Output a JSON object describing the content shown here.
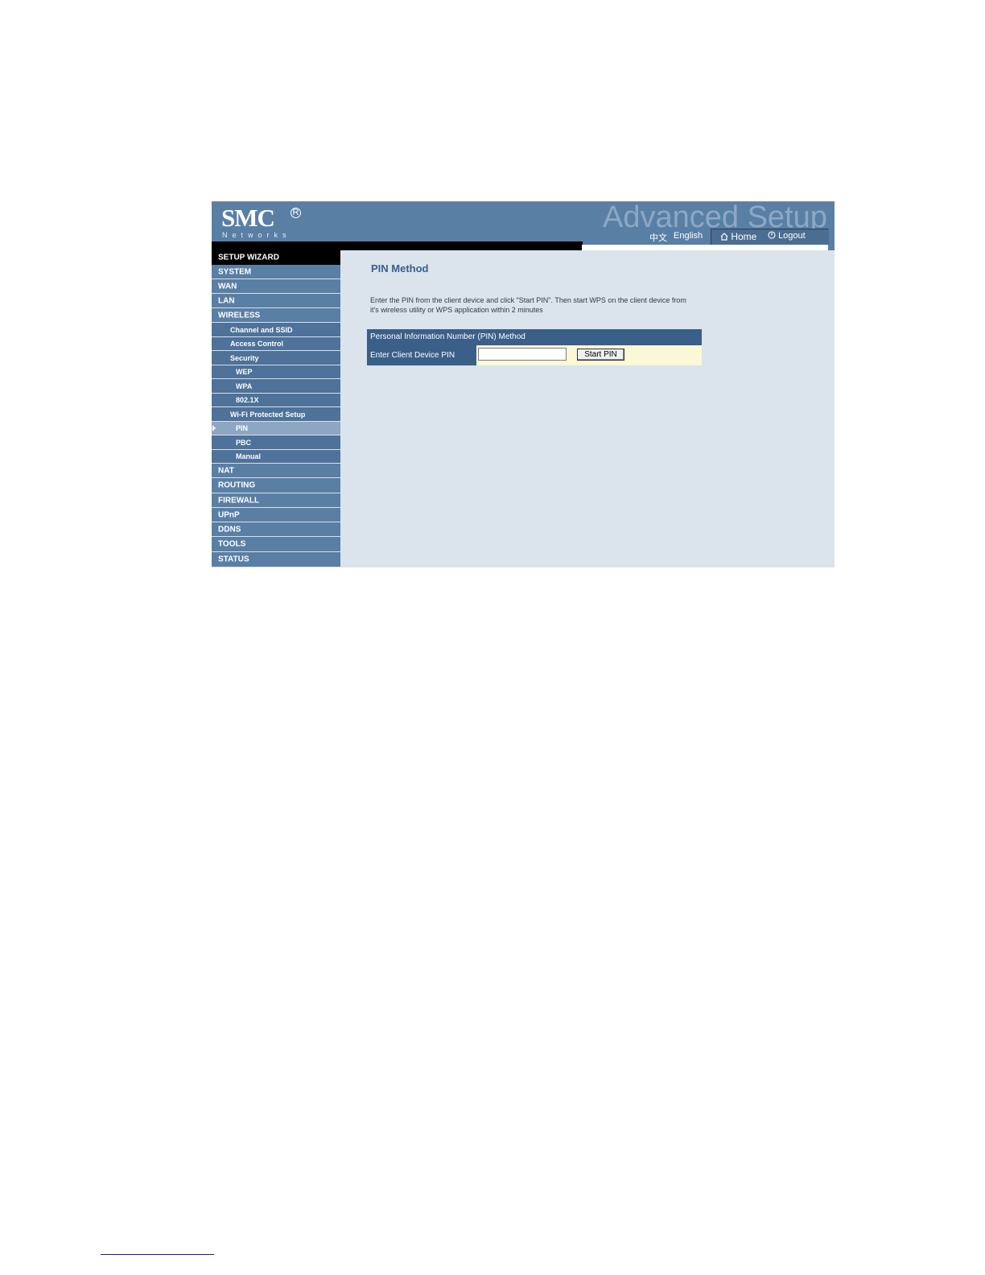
{
  "header": {
    "logo_text": "SMC",
    "logo_sub": "Networks",
    "logo_reg": "R",
    "title": "Advanced Setup",
    "lang_chinese": "中文",
    "lang_english": "English",
    "home": "Home",
    "logout": "Logout"
  },
  "sidebar": {
    "items": [
      {
        "label": "SETUP WIZARD"
      },
      {
        "label": "SYSTEM"
      },
      {
        "label": "WAN"
      },
      {
        "label": "LAN"
      },
      {
        "label": "WIRELESS"
      },
      {
        "label": "Channel and SSID"
      },
      {
        "label": "Access Control"
      },
      {
        "label": "Security"
      },
      {
        "label": "WEP"
      },
      {
        "label": "WPA"
      },
      {
        "label": "802.1X"
      },
      {
        "label": "Wi-Fi Protected Setup"
      },
      {
        "label": "PIN"
      },
      {
        "label": "PBC"
      },
      {
        "label": "Manual"
      },
      {
        "label": "NAT"
      },
      {
        "label": "ROUTING"
      },
      {
        "label": "FIREWALL"
      },
      {
        "label": "UPnP"
      },
      {
        "label": "DDNS"
      },
      {
        "label": "TOOLS"
      },
      {
        "label": "STATUS"
      }
    ]
  },
  "main": {
    "title": "PIN Method",
    "description": "Enter the PIN from the client device and click \"Start PIN\". Then start WPS on the client device from it's wireless utility or WPS application within 2 minutes",
    "table_header": "Personal Information Number (PIN) Method",
    "pin_label": "Enter Client Device PIN",
    "pin_value": "",
    "start_button": "Start PIN"
  },
  "colors": {
    "header_bg": "#5a7fa5",
    "content_bg": "#dbe3ec",
    "accent": "#3a5f88"
  }
}
